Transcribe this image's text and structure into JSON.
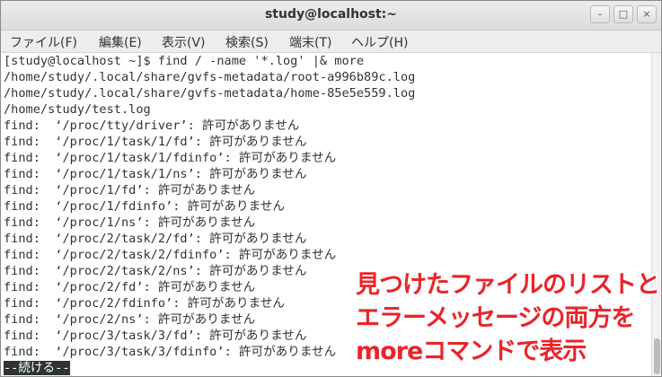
{
  "window": {
    "title": "study@localhost:~",
    "minimize_glyph": "–",
    "maximize_glyph": "□",
    "close_glyph": "×"
  },
  "menu": {
    "items": [
      "ファイル(F)",
      "編集(E)",
      "表示(V)",
      "検索(S)",
      "端末(T)",
      "ヘルプ(H)"
    ]
  },
  "terminal": {
    "lines": [
      "[study@localhost ~]$ find / -name '*.log' |& more",
      "/home/study/.local/share/gvfs-metadata/root-a996b89c.log",
      "/home/study/.local/share/gvfs-metadata/home-85e5e559.log",
      "/home/study/test.log",
      "find:  ‘/proc/tty/driver’: 許可がありません",
      "find:  ‘/proc/1/task/1/fd’: 許可がありません",
      "find:  ‘/proc/1/task/1/fdinfo’: 許可がありません",
      "find:  ‘/proc/1/task/1/ns’: 許可がありません",
      "find:  ‘/proc/1/fd’: 許可がありません",
      "find:  ‘/proc/1/fdinfo’: 許可がありません",
      "find:  ‘/proc/1/ns’: 許可がありません",
      "find:  ‘/proc/2/task/2/fd’: 許可がありません",
      "find:  ‘/proc/2/task/2/fdinfo’: 許可がありません",
      "find:  ‘/proc/2/task/2/ns’: 許可がありません",
      "find:  ‘/proc/2/fd’: 許可がありません",
      "find:  ‘/proc/2/fdinfo’: 許可がありません",
      "find:  ‘/proc/2/ns’: 許可がありません",
      "find:  ‘/proc/3/task/3/fd’: 許可がありません",
      "find:  ‘/proc/3/task/3/fdinfo’: 許可がありません"
    ],
    "more_prompt": "--続ける--"
  },
  "annotation": {
    "lines": [
      "見つけたファイルのリストと",
      "エラーメッセージの両方を",
      "moreコマンドで表示"
    ],
    "color": "#e8252a"
  }
}
